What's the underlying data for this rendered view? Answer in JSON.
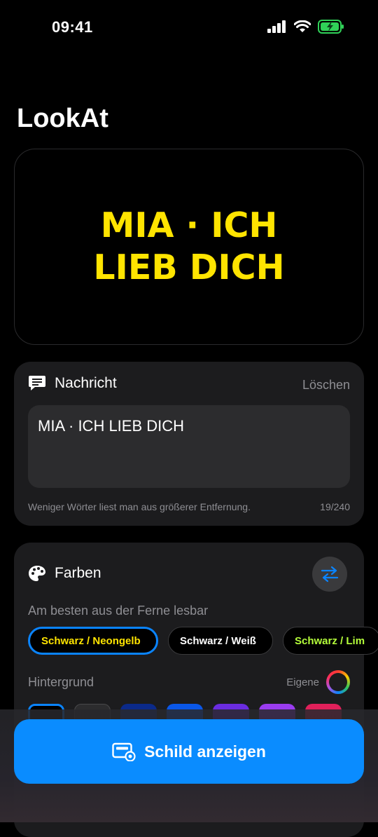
{
  "status_bar": {
    "time": "09:41"
  },
  "app": {
    "title": "LookAt"
  },
  "preview": {
    "line1": "MIA · ICH",
    "line2": "LIEB DICH",
    "text_color": "#ffe400",
    "background": "#000000"
  },
  "message": {
    "title": "Nachricht",
    "clear_label": "Löschen",
    "value": "MIA · ICH LIEB DICH",
    "hint": "Weniger Wörter liest man aus größerer Entfernung.",
    "counter": "19/240"
  },
  "colors": {
    "title": "Farben",
    "presets_label": "Am besten aus der Ferne lesbar",
    "presets": [
      {
        "label": "Schwarz / Neongelb",
        "text_color": "#ffe400",
        "selected": true
      },
      {
        "label": "Schwarz / Weiß",
        "text_color": "#ffffff",
        "selected": false
      },
      {
        "label": "Schwarz / Lim",
        "text_color": "#b5ff3b",
        "selected": false
      }
    ],
    "background_label": "Hintergrund",
    "custom_label": "Eigene",
    "swatches": [
      "#000000",
      "#2c2c2e",
      "#0b2a8a",
      "#0a57e8",
      "#6a2ce0",
      "#9a3cf0",
      "#e0205a"
    ]
  },
  "cta": {
    "label": "Schild anzeigen",
    "color": "#0a8cff"
  }
}
